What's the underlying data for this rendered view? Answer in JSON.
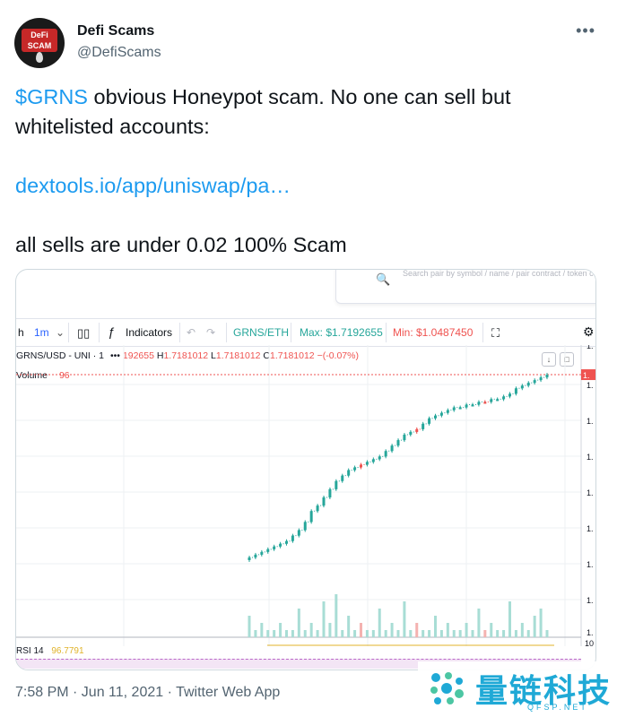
{
  "tweet": {
    "author_name": "Defi Scams",
    "handle": "@DefiScams",
    "avatar_text": "DeFi SCAM",
    "more_label": "•••",
    "ticker": "$GRNS",
    "line1_rest": " obvious Honeypot scam. No one can sell but whitelisted accounts:",
    "link": "dextools.io/app/uniswap/pa…",
    "line3": "all sells are under 0.02 100% Scam",
    "timestamp": "7:58 PM · Jun 11, 2021 · Twitter Web App"
  },
  "screenshot": {
    "search_placeholder": "Search pair by symbol / name / pair contract / token c",
    "toolbar": {
      "interval_h": "h",
      "interval_1m": "1m",
      "indicators": "Indicators",
      "pair": "GRNS/ETH",
      "max": "Max: $1.7192655",
      "min": "Min: $1.0487450"
    },
    "legend": {
      "symbol": "GRNS/USD - UNI · 1",
      "o_val": "192655",
      "h_label": "H",
      "h_val": "1.7181012",
      "l_label": "L",
      "l_val": "1.7181012",
      "c_label": "C",
      "c_val": "1.7181012",
      "change": "−(-0.07%)"
    },
    "volume_label": "Volume",
    "volume_value": "96",
    "rsi_label": "RSI 14",
    "rsi_value": "96.7791",
    "price_tag": "1.",
    "axis_label": "1.",
    "rsi_axis": "10"
  },
  "chart_data": {
    "type": "candlestick",
    "series": [
      {
        "name": "price",
        "values": [
          1.05,
          1.06,
          1.07,
          1.08,
          1.09,
          1.1,
          1.11,
          1.13,
          1.15,
          1.18,
          1.22,
          1.24,
          1.27,
          1.3,
          1.33,
          1.35,
          1.37,
          1.38,
          1.39,
          1.4,
          1.41,
          1.42,
          1.44,
          1.46,
          1.48,
          1.5,
          1.51,
          1.52,
          1.54,
          1.56,
          1.57,
          1.58,
          1.59,
          1.6,
          1.6,
          1.61,
          1.61,
          1.62,
          1.62,
          1.63,
          1.63,
          1.64,
          1.65,
          1.67,
          1.68,
          1.69,
          1.7,
          1.71,
          1.72
        ]
      },
      {
        "name": "volume",
        "values": [
          3,
          1,
          2,
          1,
          1,
          2,
          1,
          1,
          4,
          1,
          2,
          1,
          5,
          2,
          6,
          1,
          3,
          1,
          2,
          1,
          1,
          4,
          1,
          2,
          1,
          5,
          1,
          2,
          1,
          1,
          3,
          1,
          2,
          1,
          1,
          2,
          1,
          4,
          1,
          2,
          1,
          1,
          5,
          1,
          2,
          1,
          3,
          4,
          1
        ]
      }
    ],
    "down_indices": [
      18,
      27,
      38
    ],
    "ylim": [
      1.04,
      1.73
    ]
  },
  "colors": {
    "link": "#1d9bf0",
    "up": "#26a69a",
    "down": "#ef5350",
    "watermark": "#1fa9d6"
  },
  "watermark": {
    "cn": "量链科技",
    "en": "QFSP.NET"
  }
}
